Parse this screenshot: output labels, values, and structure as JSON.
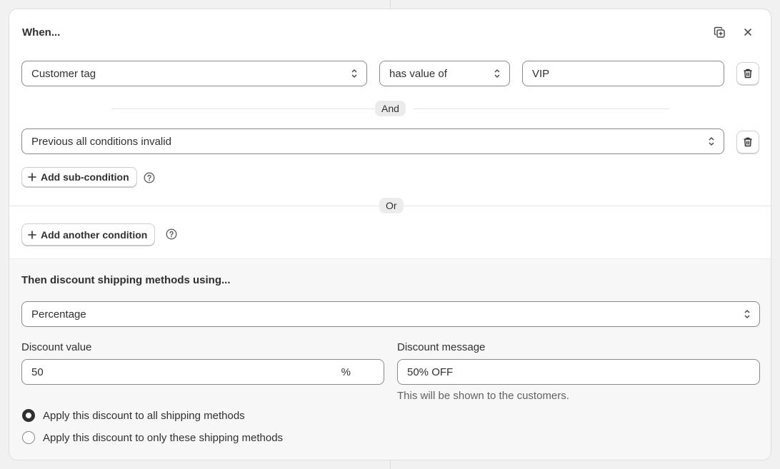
{
  "condition_block": {
    "title": "When...",
    "copy_icon": "duplicate-icon",
    "close_icon": "close-icon",
    "rule1": {
      "field": "Customer tag",
      "operator": "has value of",
      "value": "VIP"
    },
    "and_label": "And",
    "rule2": {
      "field": "Previous all conditions invalid"
    },
    "add_sub_condition": "Add sub-condition",
    "or_label": "Or",
    "add_another_condition": "Add another condition"
  },
  "discount_block": {
    "title": "Then discount shipping methods using...",
    "method": "Percentage",
    "discount_value_label": "Discount value",
    "discount_value": "50",
    "discount_value_suffix": "%",
    "discount_message_label": "Discount message",
    "discount_message": "50% OFF",
    "discount_message_hint": "This will be shown to the customers.",
    "radio_options": [
      {
        "label": "Apply this discount to all shipping methods",
        "selected": true
      },
      {
        "label": "Apply this discount to only these shipping methods",
        "selected": false
      }
    ]
  },
  "colors": {
    "text": "#303030",
    "muted": "#616161",
    "border": "#8a8a8a",
    "panel": "#f7f7f7"
  }
}
